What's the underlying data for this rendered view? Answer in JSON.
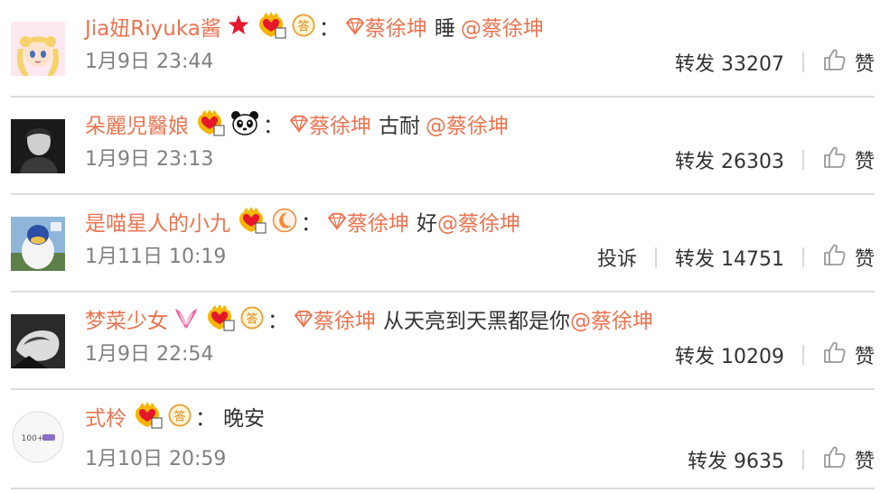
{
  "comments": [
    {
      "username": "Jia妞Riyuka酱",
      "mention_prefix": "蔡徐坤",
      "text": "睡",
      "mention_suffix": "@蔡徐坤",
      "date": "1月9日 23:44",
      "repost_label": "转发",
      "repost_count": "33207",
      "like_label": "赞",
      "badges": [
        "red-star",
        "vip-level-4",
        "answer-badge"
      ]
    },
    {
      "username": "朵麗児醫娘",
      "mention_prefix": "蔡徐坤",
      "text": "古耐",
      "mention_suffix": "@蔡徐坤",
      "date": "1月9日 23:13",
      "repost_label": "转发",
      "repost_count": "26303",
      "like_label": "赞",
      "badges": [
        "vip-level-3",
        "panda"
      ]
    },
    {
      "username": "是喵星人的小九",
      "mention_prefix": "蔡徐坤",
      "text": "好",
      "mention_suffix": "@蔡徐坤",
      "date": "1月11日 10:19",
      "report_label": "投诉",
      "repost_label": "转发",
      "repost_count": "14751",
      "like_label": "赞",
      "badges": [
        "vip-level-3",
        "moon-badge"
      ]
    },
    {
      "username": "梦菜少女",
      "mention_prefix": "蔡徐坤",
      "text": "从天亮到天黑都是你",
      "mention_suffix": "@蔡徐坤",
      "date": "1月9日 22:54",
      "repost_label": "转发",
      "repost_count": "10209",
      "like_label": "赞",
      "badges": [
        "bunny-ears",
        "vip-level-4",
        "answer-badge"
      ]
    },
    {
      "username": "式柃",
      "text": "晚安",
      "date": "1月10日 20:59",
      "repost_label": "转发",
      "repost_count": "9635",
      "like_label": "赞",
      "badges": [
        "vip-level-4",
        "answer-badge"
      ],
      "avatar_text": "100+"
    }
  ],
  "colon": "：",
  "answer_badge_char": "答",
  "colors": {
    "accent": "#eb7350",
    "text": "#333333",
    "meta": "#808080",
    "divider": "#dcdcdc"
  }
}
